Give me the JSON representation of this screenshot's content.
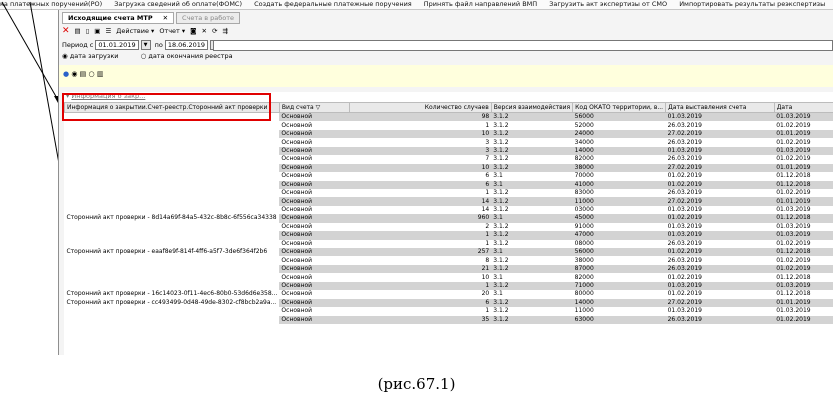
{
  "topbar": [
    "ка платежных поручений(РО)",
    "Загрузка сведений об оплате(ФОМС)",
    "Создать федеральные платежные поручения",
    "Принять файл направлений ВМП",
    "Загрузить акт экспертизы от СМО",
    "Импортировать результаты реэкспертизы"
  ],
  "tabs": {
    "active": "Исходящие счета МТР",
    "inactive": "Счета в работе",
    "close": "✕"
  },
  "toolbar": {
    "action": "Действие ▾",
    "report": "Отчет ▾"
  },
  "period": {
    "label_from": "Период с",
    "from": "01.01.2019",
    "label_to": "по",
    "to": "18.06.2019"
  },
  "radios": {
    "load": "дата загрузки",
    "registry": "дата окончания реестра"
  },
  "group_label": "Информация о закр...",
  "columns": [
    "Информация о закрытии.Счет-реестр.Сторонний акт проверки",
    "Вид счета",
    "Количество случаев",
    "Версия взаимодействия",
    "Код ОКАТО территории, в...",
    "Дата выставления счета",
    "Дата"
  ],
  "rows": [
    {
      "info": "",
      "kind": "Основной",
      "count": "98",
      "ver": "3.1.2",
      "okato": "56000",
      "issued": "01.03.2019",
      "date": "01.03.2019"
    },
    {
      "info": "",
      "kind": "Основной",
      "count": "1",
      "ver": "3.1.2",
      "okato": "52000",
      "issued": "26.03.2019",
      "date": "01.02.2019"
    },
    {
      "info": "",
      "kind": "Основной",
      "count": "10",
      "ver": "3.1.2",
      "okato": "24000",
      "issued": "27.02.2019",
      "date": "01.01.2019"
    },
    {
      "info": "",
      "kind": "Основной",
      "count": "3",
      "ver": "3.1.2",
      "okato": "34000",
      "issued": "26.03.2019",
      "date": "01.02.2019"
    },
    {
      "info": "",
      "kind": "Основной",
      "count": "3",
      "ver": "3.1.2",
      "okato": "14000",
      "issued": "01.03.2019",
      "date": "01.03.2019"
    },
    {
      "info": "",
      "kind": "Основной",
      "count": "7",
      "ver": "3.1.2",
      "okato": "82000",
      "issued": "26.03.2019",
      "date": "01.02.2019"
    },
    {
      "info": "",
      "kind": "Основной",
      "count": "10",
      "ver": "3.1.2",
      "okato": "38000",
      "issued": "27.02.2019",
      "date": "01.01.2019"
    },
    {
      "info": "",
      "kind": "Основной",
      "count": "6",
      "ver": "3.1",
      "okato": "70000",
      "issued": "01.02.2019",
      "date": "01.12.2018"
    },
    {
      "info": "",
      "kind": "Основной",
      "count": "6",
      "ver": "3.1",
      "okato": "41000",
      "issued": "01.02.2019",
      "date": "01.12.2018"
    },
    {
      "info": "",
      "kind": "Основной",
      "count": "1",
      "ver": "3.1.2",
      "okato": "83000",
      "issued": "26.03.2019",
      "date": "01.02.2019"
    },
    {
      "info": "",
      "kind": "Основной",
      "count": "14",
      "ver": "3.1.2",
      "okato": "11000",
      "issued": "27.02.2019",
      "date": "01.01.2019"
    },
    {
      "info": "",
      "kind": "Основной",
      "count": "14",
      "ver": "3.1.2",
      "okato": "03000",
      "issued": "01.03.2019",
      "date": "01.03.2019"
    },
    {
      "info": "Сторонний акт проверки - 8d14a69f-84a5-432c-8b8c-6f556ca34338",
      "kind": "Основной",
      "count": "960",
      "ver": "3.1",
      "okato": "45000",
      "issued": "01.02.2019",
      "date": "01.12.2018"
    },
    {
      "info": "",
      "kind": "Основной",
      "count": "2",
      "ver": "3.1.2",
      "okato": "91000",
      "issued": "01.03.2019",
      "date": "01.03.2019"
    },
    {
      "info": "",
      "kind": "Основной",
      "count": "1",
      "ver": "3.1.2",
      "okato": "47000",
      "issued": "01.03.2019",
      "date": "01.03.2019"
    },
    {
      "info": "",
      "kind": "Основной",
      "count": "1",
      "ver": "3.1.2",
      "okato": "08000",
      "issued": "26.03.2019",
      "date": "01.02.2019"
    },
    {
      "info": "Сторонний акт проверки - eaaf8e9f-814f-4ff6-a5f7-3de6f364f2b6",
      "kind": "Основной",
      "count": "257",
      "ver": "3.1",
      "okato": "56000",
      "issued": "01.02.2019",
      "date": "01.12.2018"
    },
    {
      "info": "",
      "kind": "Основной",
      "count": "8",
      "ver": "3.1.2",
      "okato": "38000",
      "issued": "26.03.2019",
      "date": "01.02.2019"
    },
    {
      "info": "",
      "kind": "Основной",
      "count": "21",
      "ver": "3.1.2",
      "okato": "87000",
      "issued": "26.03.2019",
      "date": "01.02.2019"
    },
    {
      "info": "",
      "kind": "Основной",
      "count": "10",
      "ver": "3.1",
      "okato": "82000",
      "issued": "01.02.2019",
      "date": "01.12.2018"
    },
    {
      "info": "",
      "kind": "Основной",
      "count": "1",
      "ver": "3.1.2",
      "okato": "71000",
      "issued": "01.03.2019",
      "date": "01.03.2019"
    },
    {
      "info": "Сторонний акт проверки - 16c14023-0f11-4ec6-80b0-53d6d6e358...",
      "kind": "Основной",
      "count": "20",
      "ver": "3.1",
      "okato": "80000",
      "issued": "01.02.2019",
      "date": "01.12.2018"
    },
    {
      "info": "Сторонний акт проверки - cc493499-0d48-49de-8302-cf8bcb2a9a...",
      "kind": "Основной",
      "count": "6",
      "ver": "3.1.2",
      "okato": "14000",
      "issued": "27.02.2019",
      "date": "01.01.2019"
    },
    {
      "info": "",
      "kind": "Основной",
      "count": "1",
      "ver": "3.1.2",
      "okato": "11000",
      "issued": "01.03.2019",
      "date": "01.03.2019"
    },
    {
      "info": "",
      "kind": "Основной",
      "count": "35",
      "ver": "3.1.2",
      "okato": "63000",
      "issued": "26.03.2019",
      "date": "01.02.2019"
    }
  ],
  "caption": "(рис.67.1)"
}
